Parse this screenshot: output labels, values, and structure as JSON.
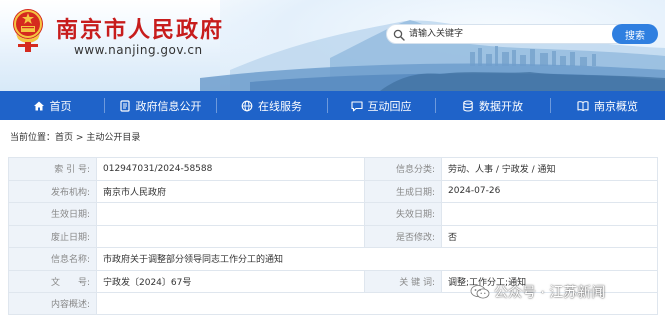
{
  "site": {
    "title": "南京市人民政府",
    "url": "www.nanjing.gov.cn"
  },
  "search": {
    "placeholder": "请输入关键字",
    "button_label": "搜索"
  },
  "nav": {
    "items": [
      {
        "label": "首页",
        "icon": "home-icon"
      },
      {
        "label": "政府信息公开",
        "icon": "document-icon"
      },
      {
        "label": "在线服务",
        "icon": "globe-icon"
      },
      {
        "label": "互动回应",
        "icon": "chat-icon"
      },
      {
        "label": "数据开放",
        "icon": "database-icon"
      },
      {
        "label": "南京概览",
        "icon": "book-icon"
      }
    ]
  },
  "breadcrumb": {
    "prefix": "当前位置：",
    "home": "首页",
    "separator": ">",
    "current": "主动公开目录"
  },
  "info": {
    "index_label": "索 引 号:",
    "index_value": "012947031/2024-58588",
    "category_label": "信息分类:",
    "category_value": "劳动、人事 / 宁政发 / 通知",
    "publisher_label": "发布机构:",
    "publisher_value": "南京市人民政府",
    "created_label": "生成日期:",
    "created_value": "2024-07-26",
    "effective_label": "生效日期:",
    "effective_value": "",
    "expiry_label": "失效日期:",
    "expiry_value": "",
    "repeal_label": "废止日期:",
    "repeal_value": "",
    "revised_label": "是否修改:",
    "revised_value": "否",
    "name_label": "信息名称:",
    "name_value": "市政府关于调整部分领导同志工作分工的通知",
    "docno_label": "文　　号:",
    "docno_value": "宁政发〔2024〕67号",
    "keywords_label": "关 键 词:",
    "keywords_value": "调整;工作分工;通知",
    "summary_label": "内容概述:",
    "summary_value": ""
  },
  "watermark": {
    "text": "公众号 · 江苏新闻",
    "icon": "wechat-icon"
  },
  "colors": {
    "nav_bg": "#1f63c9",
    "title_red": "#c71c1c",
    "search_button": "#2f7fe0",
    "label_bg": "#eef3f9"
  }
}
